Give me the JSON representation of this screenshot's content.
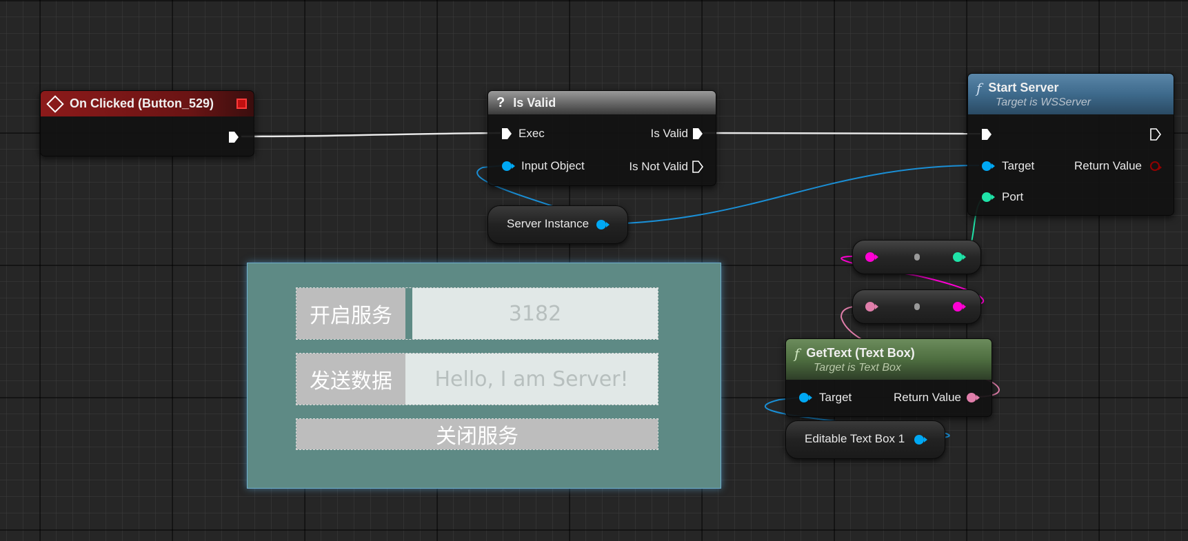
{
  "nodes": {
    "on_clicked": {
      "title": "On Clicked (Button_529)"
    },
    "is_valid": {
      "title": "Is Valid",
      "pins": {
        "exec": "Exec",
        "input_object": "Input Object",
        "is_valid": "Is Valid",
        "is_not_valid": "Is Not Valid"
      }
    },
    "start_server": {
      "title": "Start Server",
      "subtitle": "Target is WSServer",
      "pins": {
        "target": "Target",
        "port": "Port",
        "return_value": "Return Value"
      }
    },
    "server_instance": {
      "label": "Server Instance"
    },
    "get_text": {
      "title": "GetText (Text Box)",
      "subtitle": "Target is Text Box",
      "pins": {
        "target": "Target",
        "return_value": "Return Value"
      }
    },
    "editable_text_box": {
      "label": "Editable Text Box 1"
    }
  },
  "widget_preview": {
    "start_button": "开启服务",
    "port_value": "3182",
    "send_button": "发送数据",
    "message_value": "Hello, I am Server!",
    "close_button": "关闭服务"
  },
  "colors": {
    "exec": "#ffffff",
    "object": "#00a8f4",
    "int": "#1fe3a8",
    "string": "#ff00d4",
    "text": "#e07eaa",
    "bool": "#920101",
    "event_header": "#8c1a1a",
    "function_header": "#3e6a8c",
    "pure_function_header": "#5a7a4a"
  },
  "icons": {
    "event": "event-diamond-icon",
    "macro": "question-mark-icon",
    "function": "function-f-icon",
    "delegate": "delegate-square-icon"
  }
}
